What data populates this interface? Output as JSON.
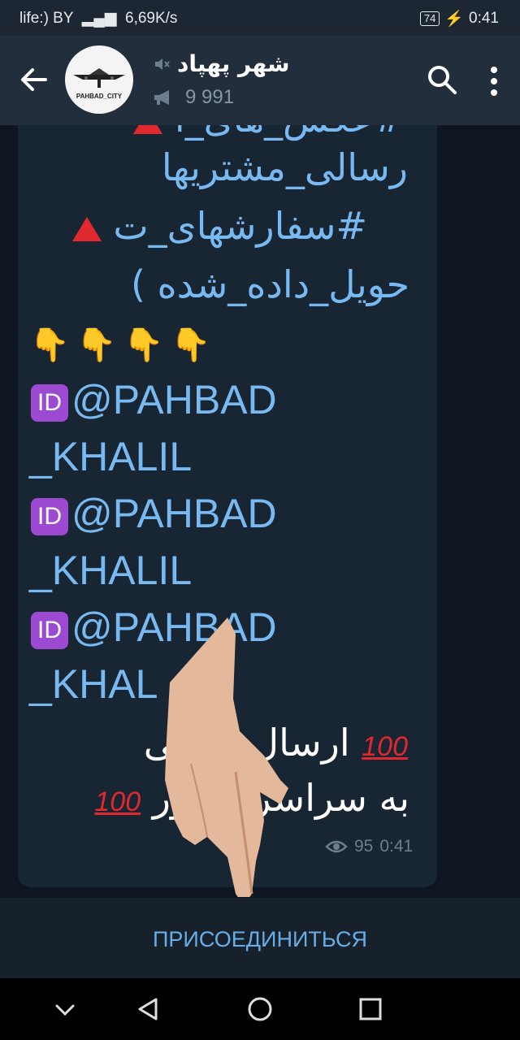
{
  "status_bar": {
    "carrier": "life:) BY",
    "speed": "6,69K/s",
    "battery": "74",
    "time": "0:41"
  },
  "header": {
    "channel_name": "شهر پهپاد",
    "avatar_caption": "PAHBAD_CITY",
    "subscribers": "9 991"
  },
  "message": {
    "lines_fa": [
      "#عکس_های_ا",
      "رسالی_مشتریها",
      "#سفارشهای_ت",
      "حویل_داده_شده )"
    ],
    "handle_1a": "@PAHBAD",
    "handle_1b": "_KHALIL",
    "handle_2a": "@PAHBAD",
    "handle_2b": "_KHALIL",
    "handle_3a": "@PAHBAD",
    "handle_3b": "_KHAL",
    "id_badge": "ID",
    "footer_line1": "ارسال ایمینی",
    "footer_line2": "به سراسر کشور",
    "hundred": "100",
    "views": "95",
    "time": "0:41"
  },
  "join_button": {
    "label": "ПРИСОЕДИНИТЬСЯ"
  },
  "colors": {
    "accent": "#67aee8",
    "text_blue": "#78b9f2",
    "red": "#e0282f",
    "badge": "#9d4ad3"
  },
  "icons": [
    "back-arrow-icon",
    "mute-icon",
    "megaphone-icon",
    "search-icon",
    "more-vert-icon",
    "eye-icon",
    "nav-back-icon",
    "nav-home-icon",
    "nav-recents-icon",
    "nav-down-icon"
  ]
}
